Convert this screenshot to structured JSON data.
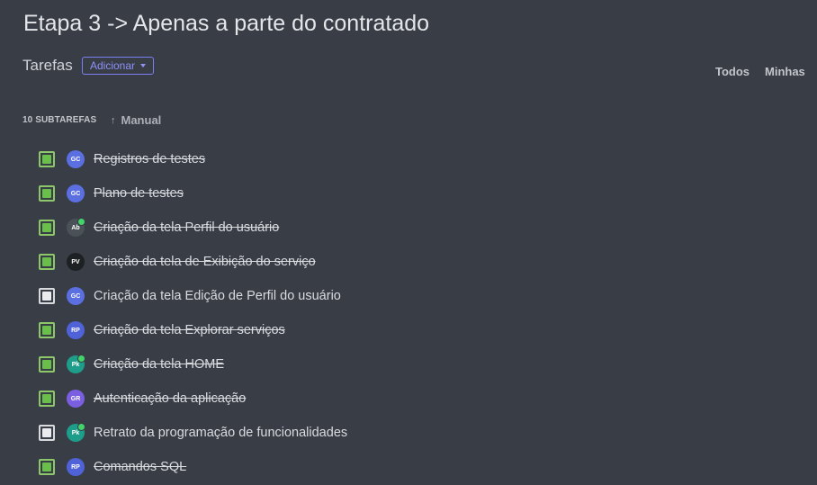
{
  "page_title": "Etapa 3 -> Apenas a parte do contratado",
  "section_label": "Tarefas",
  "add_button_label": "Adicionar",
  "filters": {
    "all": "Todos",
    "mine": "Minhas"
  },
  "subtasks_count": "10 SUBTAREFAS",
  "sort_label": "Manual",
  "colors": {
    "done_checkbox": "#6abf4b",
    "accent": "#7b7ff2",
    "online_dot": "#43d36b"
  },
  "tasks": [
    {
      "title": "Registros de testes",
      "done": true,
      "avatar": "GC",
      "avatar_color": "#5b6fe0",
      "online": false
    },
    {
      "title": "Plano de testes",
      "done": true,
      "avatar": "GC",
      "avatar_color": "#5b6fe0",
      "online": false
    },
    {
      "title": "Criação da tela Perfil do usuário",
      "done": true,
      "avatar": "Ab",
      "avatar_color": "#4a5258",
      "online": true
    },
    {
      "title": "Criação da tela de Exibição do serviço",
      "done": true,
      "avatar": "PV",
      "avatar_color": "#1e2124",
      "online": false
    },
    {
      "title": "Criação da tela Edição de Perfil do usuário",
      "done": false,
      "avatar": "GC",
      "avatar_color": "#5b6fe0",
      "online": false
    },
    {
      "title": "Criação da tela Explorar serviços",
      "done": true,
      "avatar": "RP",
      "avatar_color": "#4f62d8",
      "online": false
    },
    {
      "title": "Criação da tela HOME",
      "done": true,
      "avatar": "Pk",
      "avatar_color": "#1e9e8a",
      "online": true
    },
    {
      "title": "Autenticação da aplicação",
      "done": true,
      "avatar": "GR",
      "avatar_color": "#7a5fe0",
      "online": false
    },
    {
      "title": "Retrato da programação de funcionalidades",
      "done": false,
      "avatar": "Pk",
      "avatar_color": "#1e9e8a",
      "online": true
    },
    {
      "title": "Comandos SQL",
      "done": true,
      "avatar": "RP",
      "avatar_color": "#4f62d8",
      "online": false
    }
  ]
}
